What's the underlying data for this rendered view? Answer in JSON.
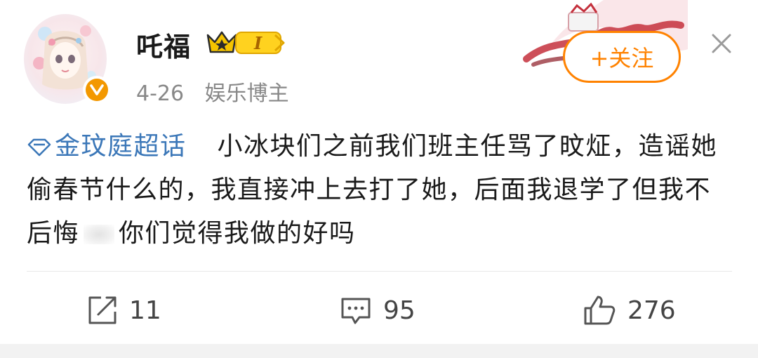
{
  "post": {
    "user": {
      "name": "吒福",
      "level_badge": "I",
      "verified": true
    },
    "date": "4-26",
    "category": "娱乐博主",
    "follow_label": "+关注",
    "topic": "金玟庭超话",
    "text_part1": "小冰块们之前我们班主任骂了旼炡，造谣她偷春节什么的，我直接冲上去打了她，后面我退学了但我不后悔",
    "text_part2": "你们觉得我做的好吗"
  },
  "actions": {
    "share_count": "11",
    "comment_count": "95",
    "like_count": "276"
  },
  "colors": {
    "accent": "#ff8200",
    "link": "#3b77b8",
    "verified": "#f39800"
  }
}
